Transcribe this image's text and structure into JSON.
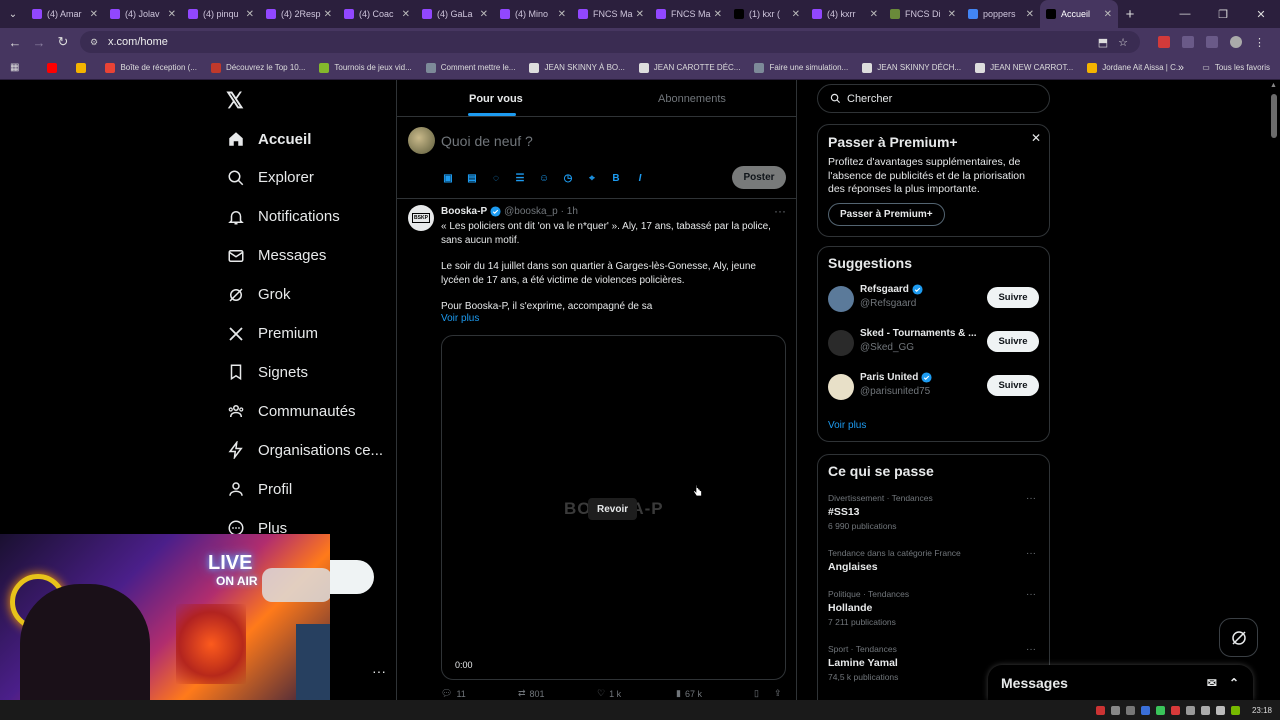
{
  "browser": {
    "tabs": [
      {
        "label": "(4) Amar",
        "color": "#9147ff"
      },
      {
        "label": "(4) Jolav",
        "color": "#9147ff"
      },
      {
        "label": "(4) pinqu",
        "color": "#9147ff"
      },
      {
        "label": "(4) 2Resp",
        "color": "#9147ff"
      },
      {
        "label": "(4) Coac",
        "color": "#9147ff"
      },
      {
        "label": "(4) GaLa",
        "color": "#9147ff"
      },
      {
        "label": "(4) Mino",
        "color": "#9147ff"
      },
      {
        "label": "FNCS Ma",
        "color": "#9147ff"
      },
      {
        "label": "FNCS Ma",
        "color": "#9147ff"
      },
      {
        "label": "(1) kxr (",
        "color": "#000000"
      },
      {
        "label": "(4) kxrr",
        "color": "#9147ff"
      },
      {
        "label": "FNCS Di",
        "color": "#6a8a3a"
      },
      {
        "label": "poppers",
        "color": "#4285f4"
      },
      {
        "label": "Accueil",
        "color": "#000000"
      }
    ],
    "url": "x.com/home",
    "bookmarks": [
      {
        "label": "",
        "color": "#ff0000"
      },
      {
        "label": "",
        "color": "#f4b400"
      },
      {
        "label": "Boîte de réception (...",
        "color": "#ea4335"
      },
      {
        "label": "Découvrez le Top 10...",
        "color": "#c0392b"
      },
      {
        "label": "Tournois de jeux vid...",
        "color": "#84b82c"
      },
      {
        "label": "Comment mettre le...",
        "color": "#7d8a99"
      },
      {
        "label": "JEAN SKINNY À BO...",
        "color": "#dddddd"
      },
      {
        "label": "JEAN CAROTTE DÉC...",
        "color": "#dddddd"
      },
      {
        "label": "Faire une simulation...",
        "color": "#7d8a99"
      },
      {
        "label": "JEAN SKINNY DÉCH...",
        "color": "#dddddd"
      },
      {
        "label": "JEAN NEW CARROT...",
        "color": "#dddddd"
      },
      {
        "label": "Jordane Ait Aissa | C...",
        "color": "#f4b400"
      }
    ],
    "bookmarks_folder": "Tous les favoris"
  },
  "nav": {
    "items": [
      {
        "label": "Accueil",
        "icon": "home-icon"
      },
      {
        "label": "Explorer",
        "icon": "search-icon"
      },
      {
        "label": "Notifications",
        "icon": "bell-icon"
      },
      {
        "label": "Messages",
        "icon": "envelope-icon"
      },
      {
        "label": "Grok",
        "icon": "grok-icon"
      },
      {
        "label": "Premium",
        "icon": "x-logo-icon"
      },
      {
        "label": "Signets",
        "icon": "bookmark-icon"
      },
      {
        "label": "Communautés",
        "icon": "community-icon"
      },
      {
        "label": "Organisations ce...",
        "icon": "lightning-icon"
      },
      {
        "label": "Profil",
        "icon": "profile-icon"
      },
      {
        "label": "Plus",
        "icon": "more-circle-icon"
      }
    ]
  },
  "feed": {
    "tabs": [
      "Pour vous",
      "Abonnements"
    ],
    "composer_placeholder": "Quoi de neuf ?",
    "post_button": "Poster",
    "tweet": {
      "avatar_text": "BSKP",
      "name": "Booska-P",
      "handle": "@booska_p",
      "time": "· 1h",
      "para1": "« Les policiers ont dit 'on va le n*quer' ». Aly, 17 ans, tabassé par la police, sans aucun motif.",
      "para2": "Le soir du 14 juillet dans son quartier à Garges-lès-Gonesse, Aly, jeune lycéen de 17 ans, a été victime de violences policières.",
      "para3": "Pour Booska-P, il s'exprime, accompagné de sa",
      "more": "Voir plus",
      "video_watermark": "BOOSKA-P",
      "replay": "Revoir",
      "video_time": "0:00",
      "replies": "11",
      "reposts": "801",
      "likes": "1 k",
      "views": "67 k"
    }
  },
  "right": {
    "search_placeholder": "Chercher",
    "premium": {
      "title": "Passer à Premium+",
      "desc": "Profitez d'avantages supplémentaires, de l'absence de publicités et de la priorisation des réponses la plus importante.",
      "button": "Passer à Premium+"
    },
    "suggestions": {
      "title": "Suggestions",
      "items": [
        {
          "name": "Refsgaard",
          "handle": "@Refsgaard",
          "verified": true,
          "button": "Suivre",
          "avatar_color": "#5b7a9a"
        },
        {
          "name": "Sked - Tournaments & ...",
          "handle": "@Sked_GG",
          "verified": false,
          "button": "Suivre",
          "avatar_color": "#2a2a2a"
        },
        {
          "name": "Paris United",
          "handle": "@parisunited75",
          "verified": true,
          "button": "Suivre",
          "avatar_color": "#e8e0c8"
        }
      ],
      "more": "Voir plus"
    },
    "trends": {
      "title": "Ce qui se passe",
      "items": [
        {
          "meta": "Divertissement · Tendances",
          "name": "#SS13",
          "count": "6 990 publications"
        },
        {
          "meta": "Tendance dans la catégorie France",
          "name": "Anglaises",
          "count": ""
        },
        {
          "meta": "Politique · Tendances",
          "name": "Hollande",
          "count": "7 211 publications"
        },
        {
          "meta": "Sport · Tendances",
          "name": "Lamine Yamal",
          "count": "74,5 k publications"
        }
      ]
    }
  },
  "messages_drawer": {
    "title": "Messages"
  },
  "webcam": {
    "sign_line1": "LIVE",
    "sign_line2": "ON AIR"
  },
  "taskbar": {
    "clock": "23:18"
  },
  "colors": {
    "accent": "#1d9bf0",
    "background": "#000000",
    "tab_strip": "#2b1f3d",
    "toolbar": "#463660"
  }
}
